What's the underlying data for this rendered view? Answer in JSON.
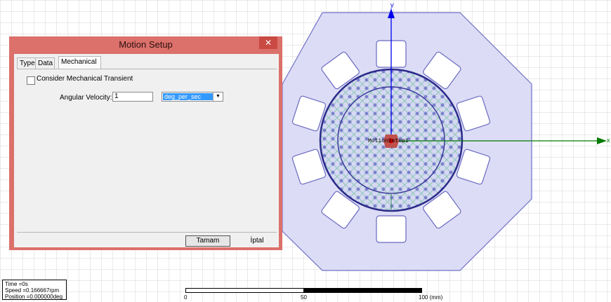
{
  "dialog": {
    "title": "Motion Setup",
    "close_glyph": "✕",
    "tabs": [
      {
        "label": "Type"
      },
      {
        "label": "Data"
      },
      {
        "label": "Mechanical"
      }
    ],
    "active_tab": "Mechanical",
    "consider_transient_label": "Consider Mechanical Transient",
    "consider_transient_checked": false,
    "angular_velocity_label": "Angular Velocity:",
    "angular_velocity_value": "1",
    "angular_velocity_unit": "deg_per_sec",
    "ok_label": "Tamam",
    "cancel_label": "İptal"
  },
  "canvas": {
    "y_axis_label": "y",
    "x_axis_label": "x",
    "center_label": "MotionSetup1",
    "colors": {
      "stator": "#dcdcf6",
      "rotor_pattern": "#8a8ad6",
      "y_axis": "#0000ee",
      "x_axis": "#007a00",
      "center": "#c0504d"
    }
  },
  "status": {
    "time": "Time    =0s",
    "speed": "Speed   =0.166667rpm",
    "position": "Position =0.000000deg"
  },
  "scale": {
    "label_0": "0",
    "label_50": "50",
    "label_100": "100 (mm)"
  }
}
